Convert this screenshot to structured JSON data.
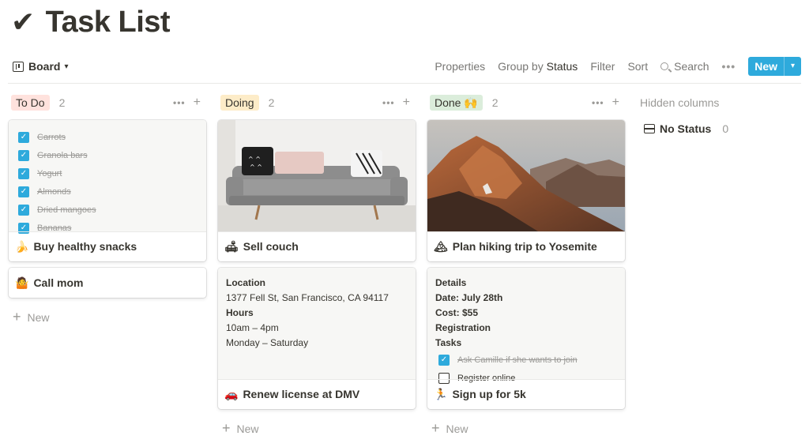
{
  "page": {
    "title": "Task List",
    "title_icon": "✔"
  },
  "toolbar": {
    "view_label": "Board",
    "properties": "Properties",
    "group_by_prefix": "Group by",
    "group_by_value": "Status",
    "filter": "Filter",
    "sort": "Sort",
    "search": "Search",
    "new_label": "New"
  },
  "columns": [
    {
      "name": "To Do",
      "count": "2",
      "tag_color": "#ffe2dd",
      "cards": [
        {
          "emoji": "🍌",
          "title": "Buy healthy snacks",
          "checklist": [
            {
              "text": "Carrots",
              "checked": true
            },
            {
              "text": "Granola bars",
              "checked": true
            },
            {
              "text": "Yogurt",
              "checked": true
            },
            {
              "text": "Almonds",
              "checked": true
            },
            {
              "text": "Dried mangoes",
              "checked": true
            },
            {
              "text": "Bananas",
              "checked": true
            }
          ]
        },
        {
          "emoji": "🤷",
          "title": "Call mom"
        }
      ],
      "new_label": "New"
    },
    {
      "name": "Doing",
      "count": "2",
      "tag_color": "#fdecc8",
      "cards": [
        {
          "emoji": "🛋",
          "title": "Sell couch",
          "image": "couch"
        },
        {
          "emoji": "🚗",
          "title": "Renew license at DMV",
          "props": {
            "location_label": "Location",
            "location": "1377 Fell St, San Francisco, CA 94117",
            "hours_label": "Hours",
            "hours_1": "10am – 4pm",
            "hours_2": "Monday – Saturday"
          }
        }
      ],
      "new_label": "New"
    },
    {
      "name": "Done 🙌",
      "count": "2",
      "tag_color": "#dbeddb",
      "cards": [
        {
          "emoji": "🏔",
          "title": "Plan hiking trip to Yosemite",
          "image": "mountain"
        },
        {
          "emoji": "🏃",
          "title": "Sign up for 5k",
          "props": {
            "details_label": "Details",
            "date": "Date: July 28th",
            "cost": "Cost: $55",
            "registration_label": "Registration",
            "tasks_label": "Tasks",
            "task_1": "Ask Camille if she wants to join",
            "task_1_checked": true,
            "task_2": "Register online",
            "task_2_checked": false
          }
        }
      ],
      "new_label": "New"
    }
  ],
  "hidden": {
    "label": "Hidden columns",
    "no_status": "No Status",
    "no_status_count": "0"
  },
  "colors": {
    "accent": "#2eaadc",
    "text": "#37352f",
    "muted": "#9b9a97"
  }
}
